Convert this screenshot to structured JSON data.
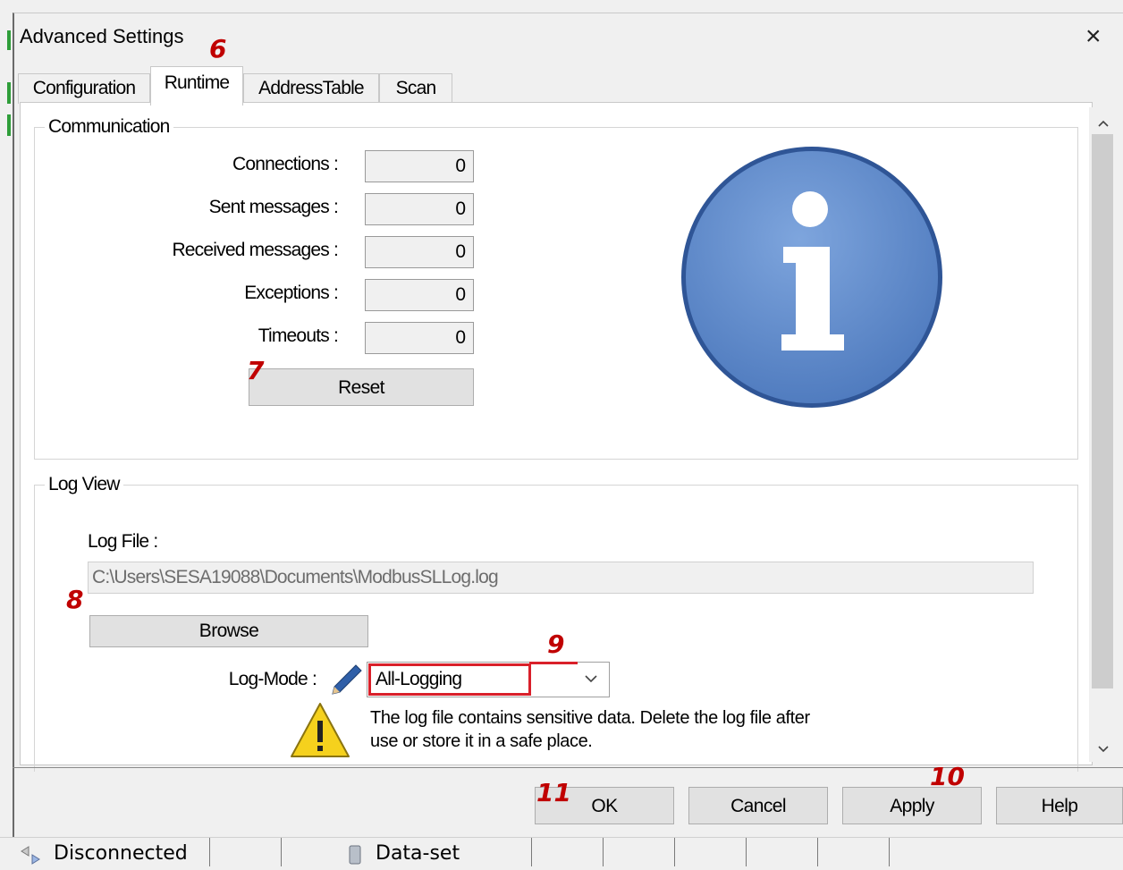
{
  "window": {
    "title": "Advanced Settings",
    "close_glyph": "×"
  },
  "tabs": [
    {
      "label": "Configuration"
    },
    {
      "label": "Runtime"
    },
    {
      "label": "AddressTable"
    },
    {
      "label": "Scan"
    }
  ],
  "communication": {
    "group_label": "Communication",
    "rows": [
      {
        "label": "Connections :",
        "value": "0"
      },
      {
        "label": "Sent messages :",
        "value": "0"
      },
      {
        "label": "Received messages :",
        "value": "0"
      },
      {
        "label": "Exceptions :",
        "value": "0"
      },
      {
        "label": "Timeouts :",
        "value": "0"
      }
    ],
    "reset_label": "Reset",
    "info_icon_glyph": "i"
  },
  "log_view": {
    "group_label": "Log View",
    "log_file_label": "Log File :",
    "log_file_path": "C:\\Users\\SESA19088\\Documents\\ModbusSLLog.log",
    "browse_label": "Browse",
    "log_mode_label": "Log-Mode :",
    "log_mode_value": "All-Logging",
    "warning_text_line1": "The log file contains sensitive data. Delete the log file after",
    "warning_text_line2": "use or store it in a safe place.",
    "warning_glyph": "!"
  },
  "buttons": {
    "ok": "OK",
    "cancel": "Cancel",
    "apply": "Apply",
    "help": "Help"
  },
  "status_bar": {
    "connection_status": "Disconnected",
    "dataset_label": "Data-set"
  },
  "annotations": {
    "tab_runtime": "6",
    "reset": "7",
    "browse": "8",
    "log_mode": "9",
    "apply": "10",
    "ok": "11"
  },
  "colors": {
    "info_icon_fill": "#5b87c9",
    "highlight_box": "#d9202a",
    "annotation_text": "#c00000",
    "warning_yellow": "#f5d11d"
  }
}
